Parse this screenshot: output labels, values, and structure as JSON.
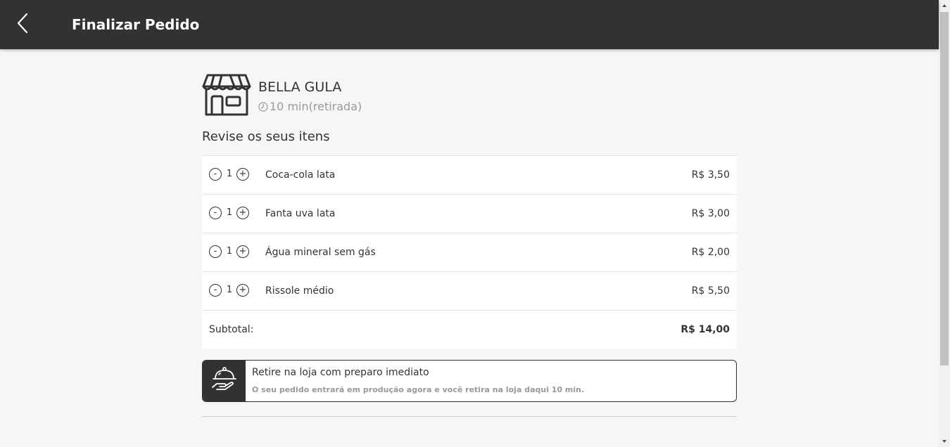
{
  "header": {
    "title": "Finalizar Pedido",
    "back_icon": "chevron-left-icon"
  },
  "store": {
    "name": "BELLA GULA",
    "icon": "storefront-icon",
    "time": "10 min",
    "mode": "(retirada)"
  },
  "review": {
    "title": "Revise os seus itens",
    "minus_label": "-",
    "plus_label": "+",
    "items": [
      {
        "qty": "1",
        "name": "Coca-cola lata",
        "price": "R$ 3,50"
      },
      {
        "qty": "1",
        "name": "Fanta uva lata",
        "price": "R$ 3,00"
      },
      {
        "qty": "1",
        "name": "Água mineral sem gás",
        "price": "R$ 2,00"
      },
      {
        "qty": "1",
        "name": "Rissole médio",
        "price": "R$ 5,50"
      }
    ],
    "subtotal_label": "Subtotal:",
    "subtotal_value": "R$ 14,00"
  },
  "pickup": {
    "icon": "serving-dish-icon",
    "title": "Retire na loja com preparo imediato",
    "description": "O seu pedido entrará em produção agora e você retira na loja daqui 10 min."
  },
  "colors": {
    "header_bg": "#323232",
    "page_bg": "#f6f6f6",
    "text": "#333333",
    "muted": "#999999"
  }
}
